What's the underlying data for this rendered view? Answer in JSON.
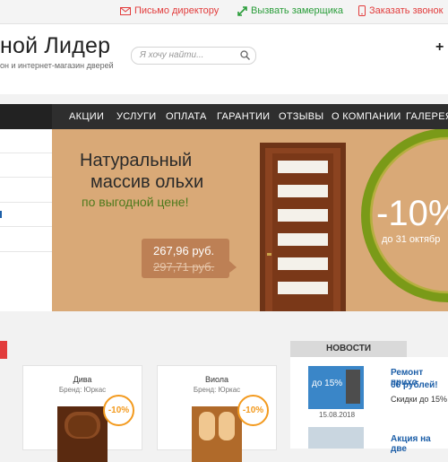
{
  "topbar": {
    "letter_label": "Письмо директору",
    "measurer_label": "Вызвать замерщика",
    "call_label": "Заказать звонок"
  },
  "header": {
    "logo_text": "ной Лидер",
    "tagline": "он и интернет-магазин дверей",
    "search_placeholder": "Я хочу найти...",
    "phone_fragment": "+"
  },
  "nav": {
    "items": [
      "АКЦИИ",
      "УСЛУГИ",
      "ОПЛАТА",
      "ГАРАНТИИ",
      "ОТЗЫВЫ",
      "О КОМПАНИИ",
      "ГАЛЕРЕЯ"
    ]
  },
  "banner": {
    "line1": "Натуральный",
    "line2": "массив ольхи",
    "line3": "по выгодной цене!",
    "price_new": "267,96 руб.",
    "price_old": "297,71 руб.",
    "discount": "-10%",
    "discount_until": "до 31 октябр"
  },
  "products": [
    {
      "name": "Дива",
      "brand": "Бренд: Юркас",
      "discount": "-10%"
    },
    {
      "name": "Виола",
      "brand": "Бренд: Юркас",
      "discount": "-10%"
    }
  ],
  "news": {
    "heading": "НОВОСТИ",
    "items": [
      {
        "title": "Ремонт прихо",
        "title2": "66 рублей!",
        "text": "Скидки до 15%",
        "badge": "до 15%",
        "date": "15.08.2018"
      },
      {
        "title": "Акция на две",
        "title2": "",
        "text": "",
        "badge": "",
        "date": ""
      }
    ]
  },
  "colors": {
    "nav_bg": "#2e2e2e",
    "accent_red": "#e23c3c",
    "accent_green": "#2a9d3a",
    "accent_orange": "#f39a1e",
    "news_link": "#1d5fa8",
    "banner_bg": "#d9a977"
  }
}
